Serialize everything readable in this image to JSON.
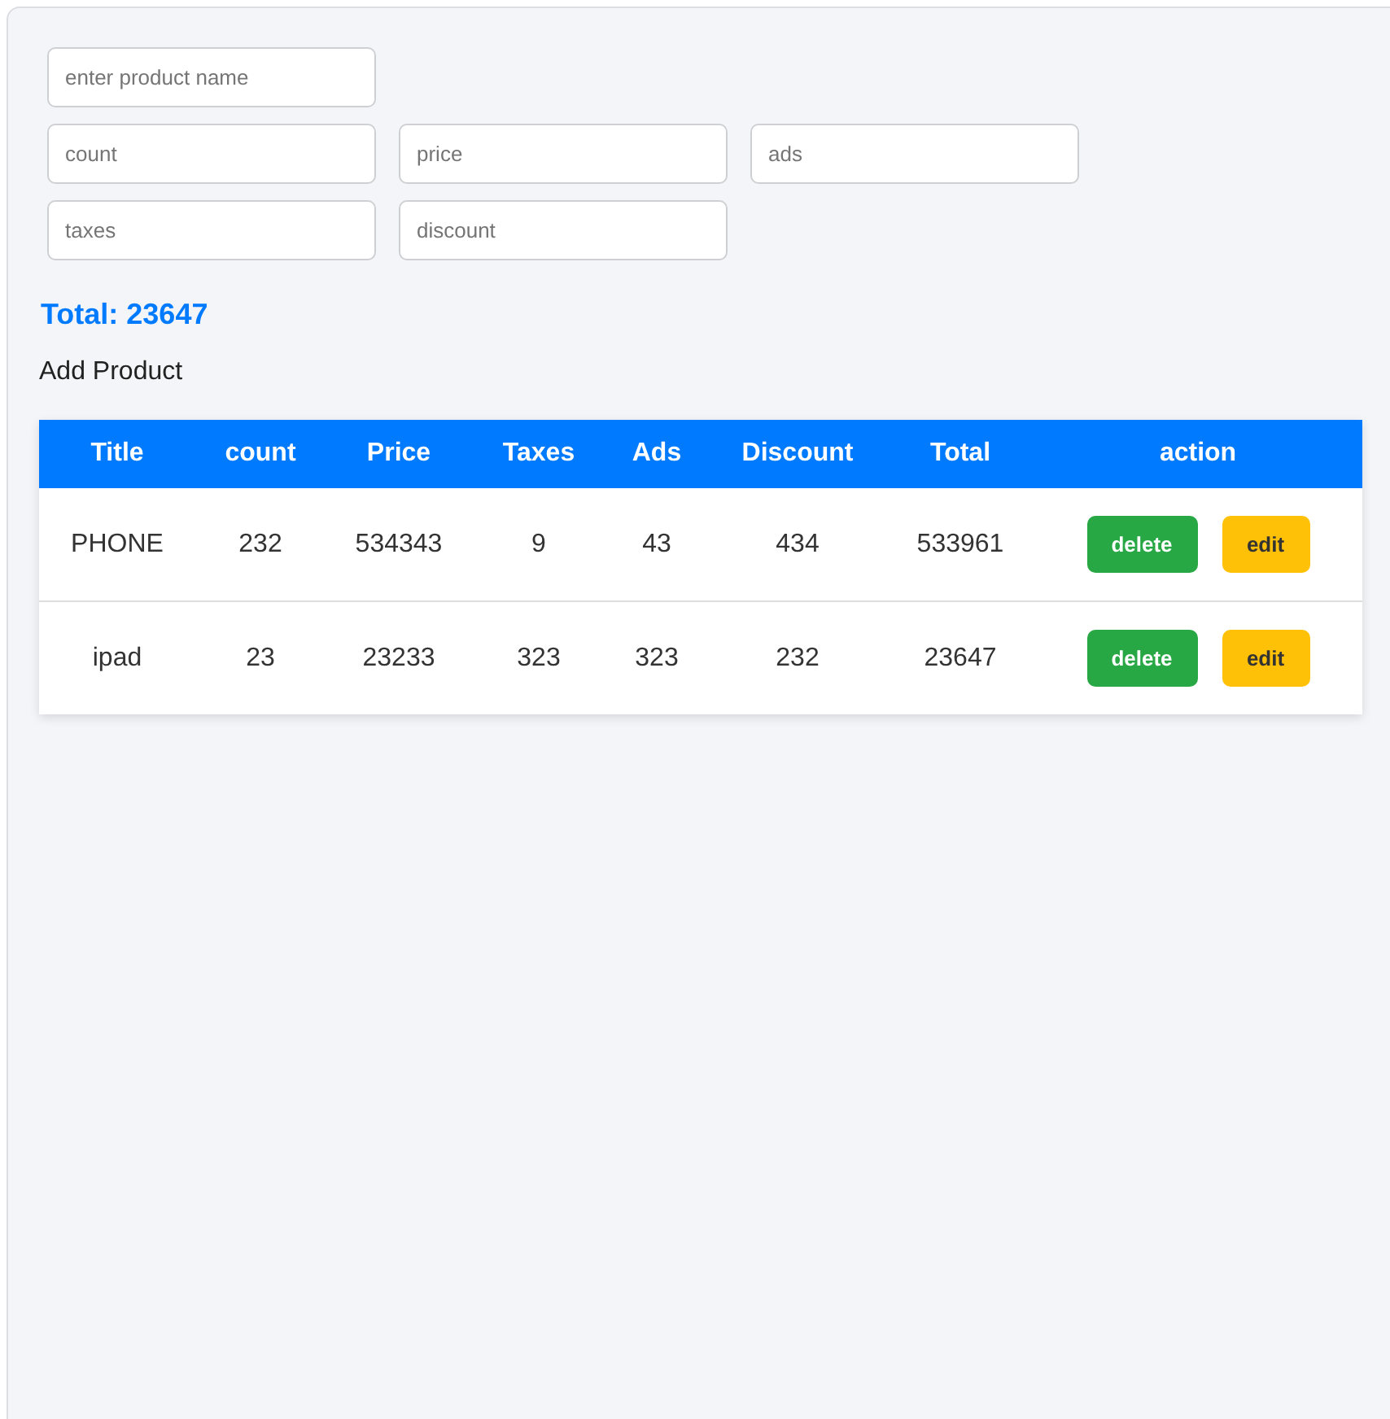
{
  "form": {
    "field_rows": [
      [
        {
          "placeholder": "enter product name"
        }
      ],
      [
        {
          "placeholder": "count"
        },
        {
          "placeholder": "price"
        },
        {
          "placeholder": "ads"
        }
      ],
      [
        {
          "placeholder": "taxes"
        },
        {
          "placeholder": "discount"
        }
      ]
    ]
  },
  "summary": {
    "total": "Total: 23647"
  },
  "add_button": {
    "label": "Add Product"
  },
  "table": {
    "columns": [
      "Title",
      "count",
      "Price",
      "Taxes",
      "Ads",
      "Discount",
      "Total",
      "action"
    ],
    "rows": [
      {
        "cells": [
          "PHONE",
          "232",
          "534343",
          "9",
          "43",
          "434",
          "533961"
        ],
        "actions": [
          {
            "label": "delete",
            "kind": "delete"
          },
          {
            "label": "edit",
            "kind": "edit"
          }
        ]
      },
      {
        "cells": [
          "ipad",
          "23",
          "23233",
          "323",
          "323",
          "232",
          "23647"
        ],
        "actions": [
          {
            "label": "delete",
            "kind": "delete"
          },
          {
            "label": "edit",
            "kind": "edit"
          }
        ]
      }
    ]
  }
}
